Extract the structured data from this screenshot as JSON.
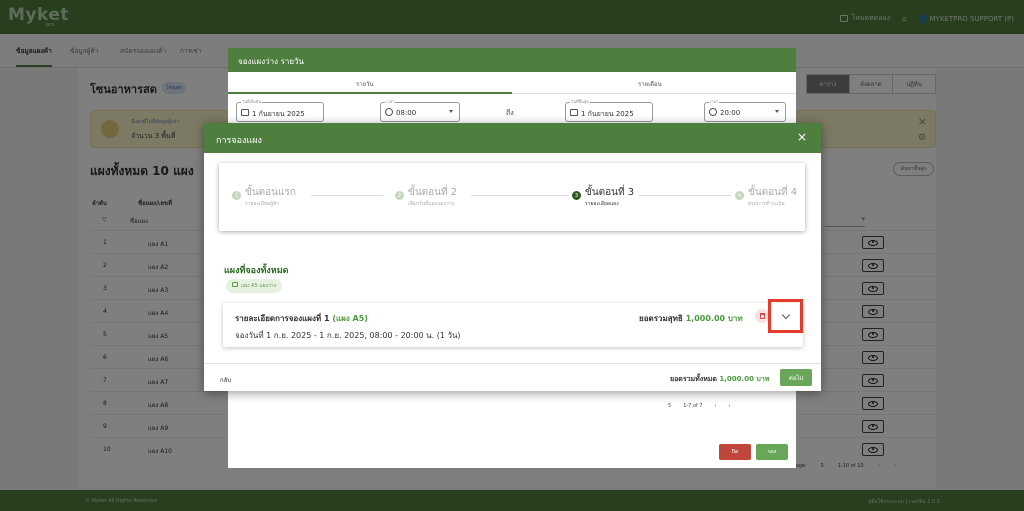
{
  "app": {
    "logo": "Myket",
    "logo_sub": "pro",
    "topbar": {
      "manual": "โหมดทดลอง",
      "user": "MYKETPRO SUPPORT (P)"
    }
  },
  "nav_tabs": [
    "ข้อมูลแผงค้า",
    "ข้อมูลผู้ค้า",
    "สมัครจองแผงค้า",
    "การเช่า"
  ],
  "zone": {
    "title": "โซนอาหารสด",
    "badge": "โซนสด"
  },
  "views": [
    "ตาราง",
    "ผังตลาด",
    "ปฏิทิน"
  ],
  "banner": {
    "title": "มีแผงที่ไม่มีข้อมูลผู้เช่า",
    "subtitle": "จำนวน 3 พื้นที่"
  },
  "stalls": {
    "title": "แผงทั้งหมด 10 แผง",
    "search_btn": "ค้นหาขั้นสูง",
    "col_order": "ลำดับ",
    "col_name": "ชื่อแผง/เลขที่",
    "filter_name": "ชื่อแผง",
    "rows": [
      {
        "num": "1",
        "name": "แผง A1"
      },
      {
        "num": "2",
        "name": "แผง A2"
      },
      {
        "num": "3",
        "name": "แผง A3"
      },
      {
        "num": "4",
        "name": "แผง A4"
      },
      {
        "num": "5",
        "name": "แผง A5"
      },
      {
        "num": "6",
        "name": "แผง A6"
      },
      {
        "num": "7",
        "name": "แผง A7"
      },
      {
        "num": "8",
        "name": "แผง A8"
      },
      {
        "num": "9",
        "name": "แผง A9"
      },
      {
        "num": "10",
        "name": "แผง A10"
      }
    ],
    "pager": {
      "rows_per_page": "Rows per page:",
      "per_page": "5",
      "range": "1-10 of 10"
    }
  },
  "footer": {
    "left": "© Myket All Rights Reserved",
    "right": "คู่มือใช้งานระบบ | เวอร์ชัน 2.0.5"
  },
  "daily_dialog": {
    "title": "จองแผงว่าง รายวัน",
    "tab_daily": "รายวัน",
    "tab_monthly": "รายเดือน",
    "start_date_label": "วันที่เริ่มต้น",
    "start_date": "1 กันยายน 2025",
    "start_time_label": "เวลา",
    "start_time": "08:00",
    "to": "ถึง",
    "end_date_label": "วันที่สิ้นสุด",
    "end_date": "1 กันยายน 2025",
    "end_time_label": "เวลา",
    "end_time": "20:00",
    "inner_pager": {
      "per_page": "5",
      "range": "1-7 of 7"
    },
    "close": "ปิด",
    "book": "จอง"
  },
  "booking_modal": {
    "title": "การจองแผง",
    "close_icon": "×",
    "steps": [
      {
        "num": "1",
        "title": "ขั้นตอนแรก",
        "subtitle": "รายละเอียดผู้ค้า"
      },
      {
        "num": "2",
        "title": "ขั้นตอนที่ 2",
        "subtitle": "เลือกวันที่และแผงว่าง"
      },
      {
        "num": "3",
        "title": "ขั้นตอนที่ 3",
        "subtitle": "รายละเอียดแผง"
      },
      {
        "num": "4",
        "title": "ขั้นตอนที่ 4",
        "subtitle": "สรุปการชำระเงิน"
      }
    ],
    "active_step": 3,
    "booked_title": "แผงที่จองทั้งหมด",
    "chip": "แผง A5 แผงว่าง",
    "detail": {
      "title": "รายละเอียดการจองแผงที่ 1",
      "stall": "(แผง A5)",
      "date_line": "จองวันที่ 1 ก.ย. 2025 - 1 ก.ย. 2025, 08:00 - 20:00 น. (1 วัน)",
      "net_label": "ยอดรวมสุทธิ",
      "net_amount": "1,000.00 บาท"
    },
    "footer": {
      "back": "กลับ",
      "grand_label": "ยอดรวมทั้งหมด",
      "grand_amount": "1,000.00 บาท",
      "next": "ต่อไป"
    }
  },
  "colors": {
    "brand": "#4e7f3f",
    "accent_green": "#4b9a3a",
    "highlight": "#e53b2c",
    "danger": "#c0463b"
  }
}
